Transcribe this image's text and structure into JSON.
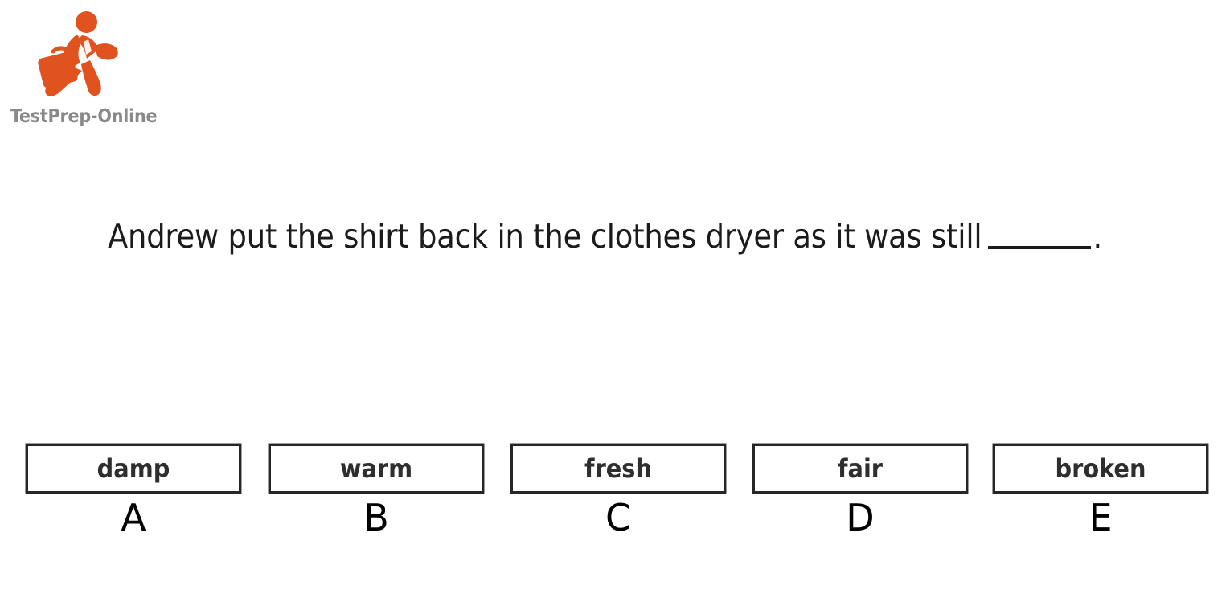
{
  "logo": {
    "icon_name": "running-businessman-with-briefcase-icon",
    "brand_text": "TestPrep-Online",
    "brand_color": "#E0531F",
    "wordmark_color": "#8a8a8a"
  },
  "question": {
    "text_before_blank": "Andrew put the shirt back in the clothes dryer as it was still",
    "blank": "_____",
    "text_after_blank": "."
  },
  "options": [
    {
      "letter": "A",
      "word": "damp"
    },
    {
      "letter": "B",
      "word": "warm"
    },
    {
      "letter": "C",
      "word": "fresh"
    },
    {
      "letter": "D",
      "word": "fair"
    },
    {
      "letter": "E",
      "word": "broken"
    }
  ],
  "colors": {
    "background": "#ffffff",
    "text": "#1b1b1b",
    "option_border": "#262626",
    "option_text": "#2e2e2e",
    "letter_text": "#000000"
  }
}
